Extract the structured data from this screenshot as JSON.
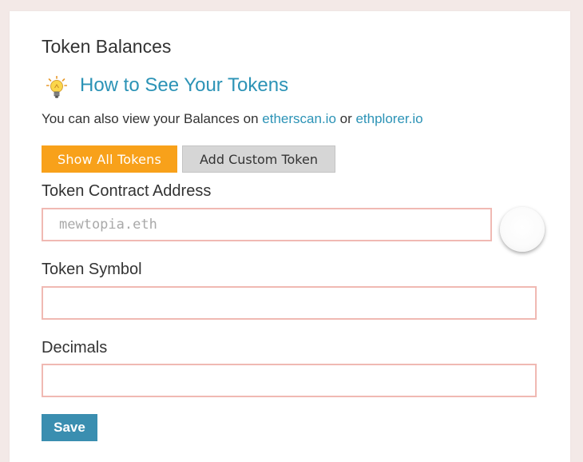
{
  "panel": {
    "title": "Token Balances",
    "help_link": "How to See Your Tokens",
    "description": {
      "prefix": "You can also view your Balances on ",
      "link1": "etherscan.io",
      "middle": " or ",
      "link2": "ethplorer.io"
    }
  },
  "buttons": {
    "show_all": "Show All Tokens",
    "add_custom": "Add Custom Token",
    "save": "Save"
  },
  "form": {
    "contract_address": {
      "label": "Token Contract Address",
      "value": "",
      "placeholder": "mewtopia.eth"
    },
    "symbol": {
      "label": "Token Symbol",
      "value": "",
      "placeholder": ""
    },
    "decimals": {
      "label": "Decimals",
      "value": "",
      "placeholder": ""
    }
  },
  "icons": {
    "help": "lightbulb-icon",
    "address_preview": "identicon"
  },
  "colors": {
    "link": "#2c93b6",
    "primary_button": "#f8a11a",
    "secondary_button": "#d6d6d6",
    "save_button": "#3a8eb0",
    "invalid_border": "#f0b9b3"
  }
}
